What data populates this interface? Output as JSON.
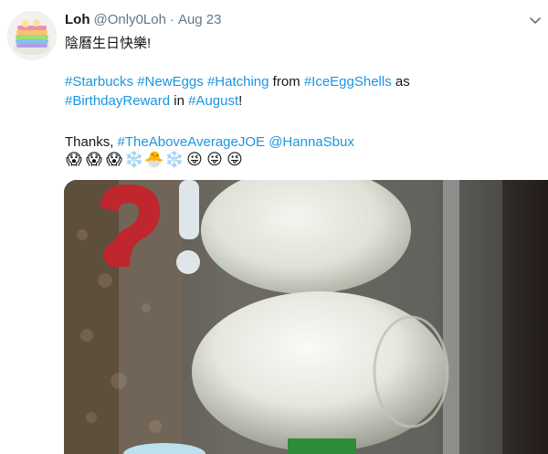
{
  "tweet": {
    "author_name": "Loh",
    "author_handle": "@Only0Loh",
    "separator": "·",
    "date": "Aug 23",
    "line1": "陰曆生日快樂!",
    "line2": {
      "h1": "#Starbucks",
      "h2": "#NewEggs",
      "h3": "#Hatching",
      "t1": "from",
      "h4": "#IceEggShells",
      "t2": "as"
    },
    "line3": {
      "h1": "#BirthdayReward",
      "t1": "in",
      "h2": "#August",
      "t2": "!"
    },
    "line4": {
      "t1": "Thanks,",
      "h1": "#TheAboveAverageJOE",
      "h2": "@HannaSbux"
    },
    "emojis": [
      "😱",
      "😱",
      "😱",
      "❄️",
      "🐣",
      "❄️",
      "😜",
      "😜",
      "😜"
    ]
  },
  "colors": {
    "link": "#1b95e0",
    "secondary": "#657786",
    "text": "#14171a"
  },
  "icons": {
    "menu": "chevron-down-icon"
  }
}
